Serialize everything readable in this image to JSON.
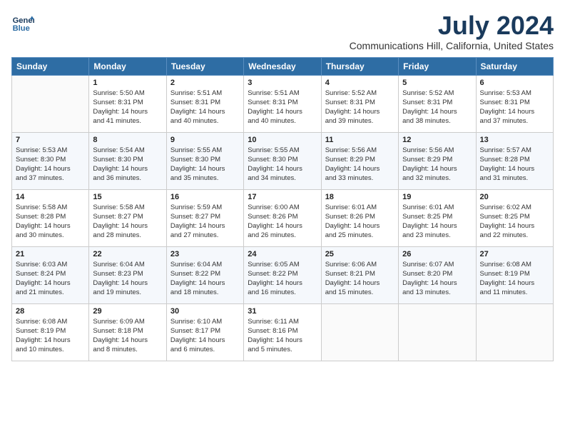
{
  "header": {
    "logo_line1": "General",
    "logo_line2": "Blue",
    "title": "July 2024",
    "subtitle": "Communications Hill, California, United States"
  },
  "days_of_week": [
    "Sunday",
    "Monday",
    "Tuesday",
    "Wednesday",
    "Thursday",
    "Friday",
    "Saturday"
  ],
  "weeks": [
    [
      {
        "day": "",
        "content": ""
      },
      {
        "day": "1",
        "content": "Sunrise: 5:50 AM\nSunset: 8:31 PM\nDaylight: 14 hours\nand 41 minutes."
      },
      {
        "day": "2",
        "content": "Sunrise: 5:51 AM\nSunset: 8:31 PM\nDaylight: 14 hours\nand 40 minutes."
      },
      {
        "day": "3",
        "content": "Sunrise: 5:51 AM\nSunset: 8:31 PM\nDaylight: 14 hours\nand 40 minutes."
      },
      {
        "day": "4",
        "content": "Sunrise: 5:52 AM\nSunset: 8:31 PM\nDaylight: 14 hours\nand 39 minutes."
      },
      {
        "day": "5",
        "content": "Sunrise: 5:52 AM\nSunset: 8:31 PM\nDaylight: 14 hours\nand 38 minutes."
      },
      {
        "day": "6",
        "content": "Sunrise: 5:53 AM\nSunset: 8:31 PM\nDaylight: 14 hours\nand 37 minutes."
      }
    ],
    [
      {
        "day": "7",
        "content": "Sunrise: 5:53 AM\nSunset: 8:30 PM\nDaylight: 14 hours\nand 37 minutes."
      },
      {
        "day": "8",
        "content": "Sunrise: 5:54 AM\nSunset: 8:30 PM\nDaylight: 14 hours\nand 36 minutes."
      },
      {
        "day": "9",
        "content": "Sunrise: 5:55 AM\nSunset: 8:30 PM\nDaylight: 14 hours\nand 35 minutes."
      },
      {
        "day": "10",
        "content": "Sunrise: 5:55 AM\nSunset: 8:30 PM\nDaylight: 14 hours\nand 34 minutes."
      },
      {
        "day": "11",
        "content": "Sunrise: 5:56 AM\nSunset: 8:29 PM\nDaylight: 14 hours\nand 33 minutes."
      },
      {
        "day": "12",
        "content": "Sunrise: 5:56 AM\nSunset: 8:29 PM\nDaylight: 14 hours\nand 32 minutes."
      },
      {
        "day": "13",
        "content": "Sunrise: 5:57 AM\nSunset: 8:28 PM\nDaylight: 14 hours\nand 31 minutes."
      }
    ],
    [
      {
        "day": "14",
        "content": "Sunrise: 5:58 AM\nSunset: 8:28 PM\nDaylight: 14 hours\nand 30 minutes."
      },
      {
        "day": "15",
        "content": "Sunrise: 5:58 AM\nSunset: 8:27 PM\nDaylight: 14 hours\nand 28 minutes."
      },
      {
        "day": "16",
        "content": "Sunrise: 5:59 AM\nSunset: 8:27 PM\nDaylight: 14 hours\nand 27 minutes."
      },
      {
        "day": "17",
        "content": "Sunrise: 6:00 AM\nSunset: 8:26 PM\nDaylight: 14 hours\nand 26 minutes."
      },
      {
        "day": "18",
        "content": "Sunrise: 6:01 AM\nSunset: 8:26 PM\nDaylight: 14 hours\nand 25 minutes."
      },
      {
        "day": "19",
        "content": "Sunrise: 6:01 AM\nSunset: 8:25 PM\nDaylight: 14 hours\nand 23 minutes."
      },
      {
        "day": "20",
        "content": "Sunrise: 6:02 AM\nSunset: 8:25 PM\nDaylight: 14 hours\nand 22 minutes."
      }
    ],
    [
      {
        "day": "21",
        "content": "Sunrise: 6:03 AM\nSunset: 8:24 PM\nDaylight: 14 hours\nand 21 minutes."
      },
      {
        "day": "22",
        "content": "Sunrise: 6:04 AM\nSunset: 8:23 PM\nDaylight: 14 hours\nand 19 minutes."
      },
      {
        "day": "23",
        "content": "Sunrise: 6:04 AM\nSunset: 8:22 PM\nDaylight: 14 hours\nand 18 minutes."
      },
      {
        "day": "24",
        "content": "Sunrise: 6:05 AM\nSunset: 8:22 PM\nDaylight: 14 hours\nand 16 minutes."
      },
      {
        "day": "25",
        "content": "Sunrise: 6:06 AM\nSunset: 8:21 PM\nDaylight: 14 hours\nand 15 minutes."
      },
      {
        "day": "26",
        "content": "Sunrise: 6:07 AM\nSunset: 8:20 PM\nDaylight: 14 hours\nand 13 minutes."
      },
      {
        "day": "27",
        "content": "Sunrise: 6:08 AM\nSunset: 8:19 PM\nDaylight: 14 hours\nand 11 minutes."
      }
    ],
    [
      {
        "day": "28",
        "content": "Sunrise: 6:08 AM\nSunset: 8:19 PM\nDaylight: 14 hours\nand 10 minutes."
      },
      {
        "day": "29",
        "content": "Sunrise: 6:09 AM\nSunset: 8:18 PM\nDaylight: 14 hours\nand 8 minutes."
      },
      {
        "day": "30",
        "content": "Sunrise: 6:10 AM\nSunset: 8:17 PM\nDaylight: 14 hours\nand 6 minutes."
      },
      {
        "day": "31",
        "content": "Sunrise: 6:11 AM\nSunset: 8:16 PM\nDaylight: 14 hours\nand 5 minutes."
      },
      {
        "day": "",
        "content": ""
      },
      {
        "day": "",
        "content": ""
      },
      {
        "day": "",
        "content": ""
      }
    ]
  ]
}
